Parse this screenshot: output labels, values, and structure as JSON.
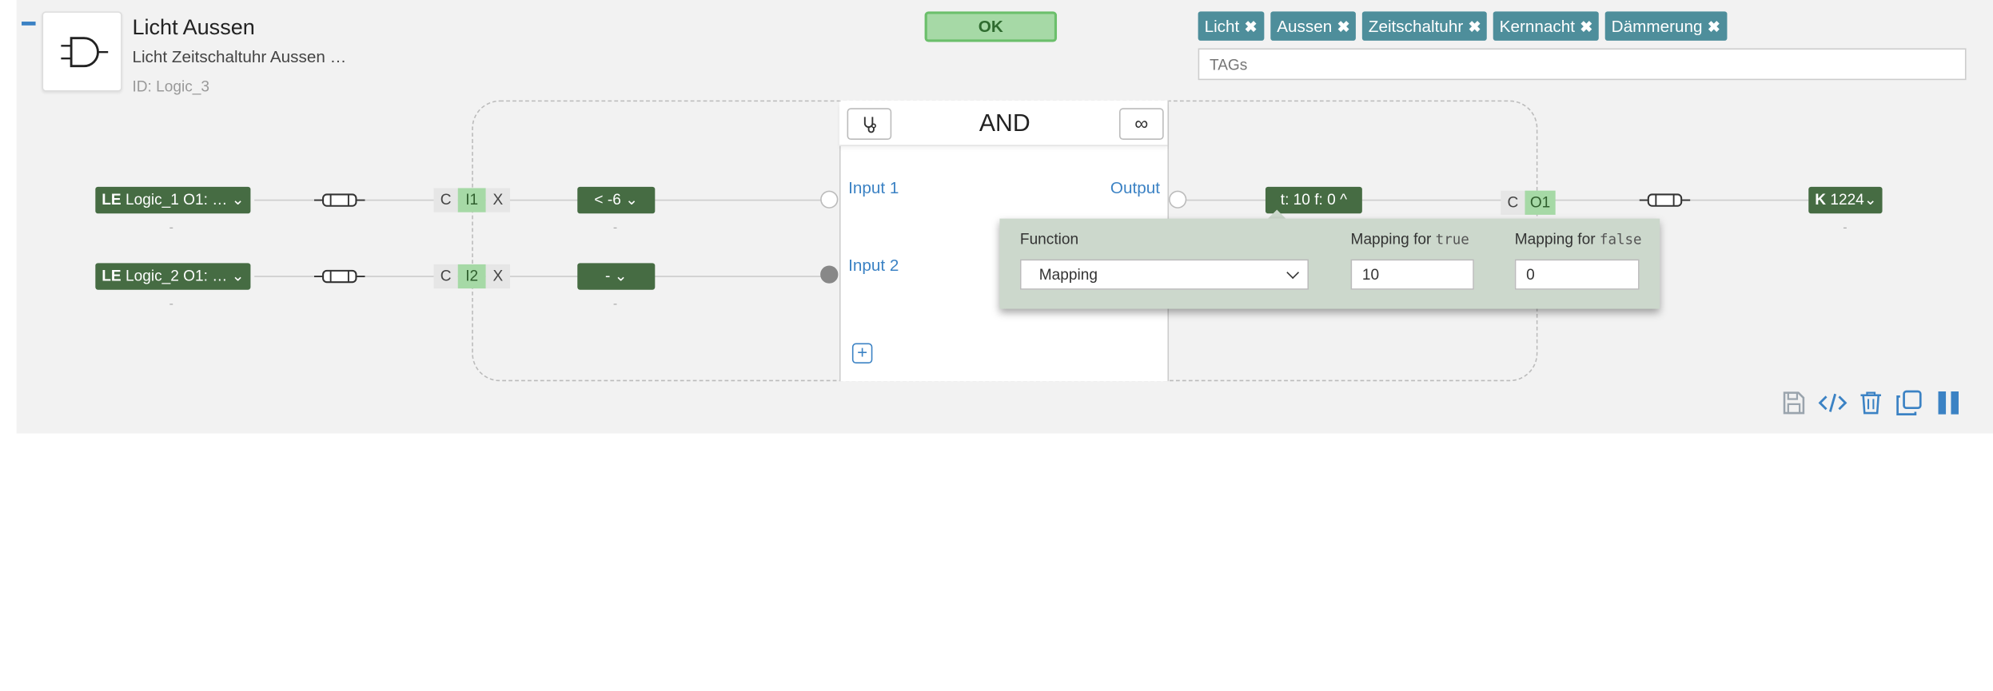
{
  "node": {
    "title": "Licht Aussen",
    "description": "Licht Zeitschaltuhr Aussen …",
    "id": "ID: Logic_3",
    "icon": "and-gate-icon"
  },
  "status": {
    "label": "OK",
    "color": "#a6d9a6"
  },
  "tags": {
    "items": [
      "Licht",
      "Aussen",
      "Zeitschaltuhr",
      "Kernnacht",
      "Dämmerung"
    ],
    "remove_glyph": "✖",
    "placeholder": "TAGs"
  },
  "logic": {
    "type": "AND",
    "inputs_label": [
      "Input 1",
      "Input 2"
    ],
    "output_label": "Output",
    "add_input_glyph": "+"
  },
  "inputs": [
    {
      "source_prefix": "LE",
      "source_text": "Logic_1 O1: …",
      "c_label": "C",
      "port": "I1",
      "x_label": "X",
      "filter": "< -6",
      "under_source": "-",
      "under_filter": "-"
    },
    {
      "source_prefix": "LE",
      "source_text": "Logic_2 O1: …",
      "c_label": "C",
      "port": "I2",
      "x_label": "X",
      "filter": "-",
      "under_source": "-",
      "under_filter": "-"
    }
  ],
  "output": {
    "mapping_btn": "t: 10 f: 0",
    "c_label": "C",
    "port": "O1",
    "target_prefix": "K",
    "target_text": "1224",
    "under_target": "-"
  },
  "popup": {
    "function_label": "Function",
    "function_value": "Mapping",
    "true_label": "Mapping for",
    "true_code": "true",
    "true_value": "10",
    "false_label": "Mapping for",
    "false_code": "false",
    "false_value": "0"
  },
  "colors": {
    "accent": "#3b82c4",
    "dark_green": "#466c43",
    "tag": "#4e8e9b",
    "popup_bg": "#ccd8cc"
  }
}
